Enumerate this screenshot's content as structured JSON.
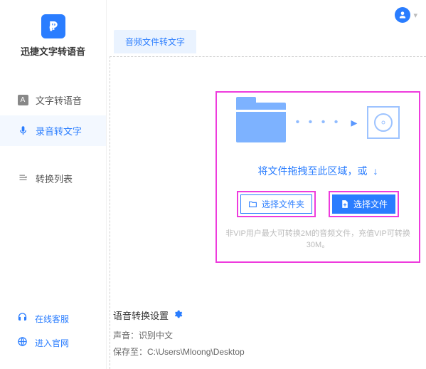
{
  "app": {
    "title": "迅捷文字转语音"
  },
  "nav": {
    "items": [
      {
        "label": "文字转语音"
      },
      {
        "label": "录音转文字"
      },
      {
        "label": "转换列表"
      }
    ]
  },
  "bottom": {
    "support": "在线客服",
    "website": "进入官网"
  },
  "tabs": {
    "active": "音频文件转文字"
  },
  "dropzone": {
    "text": "将文件拖拽至此区域，或",
    "arrow": "↓",
    "select_folder": "选择文件夹",
    "select_file": "选择文件",
    "hint": "非VIP用户最大可转换2M的音频文件，充值VIP可转换30M。"
  },
  "settings": {
    "title": "语音转换设置",
    "voice_label": "声音：",
    "voice_value": "识别中文",
    "save_label": "保存至：",
    "save_value": "C:\\Users\\Mloong\\Desktop"
  }
}
